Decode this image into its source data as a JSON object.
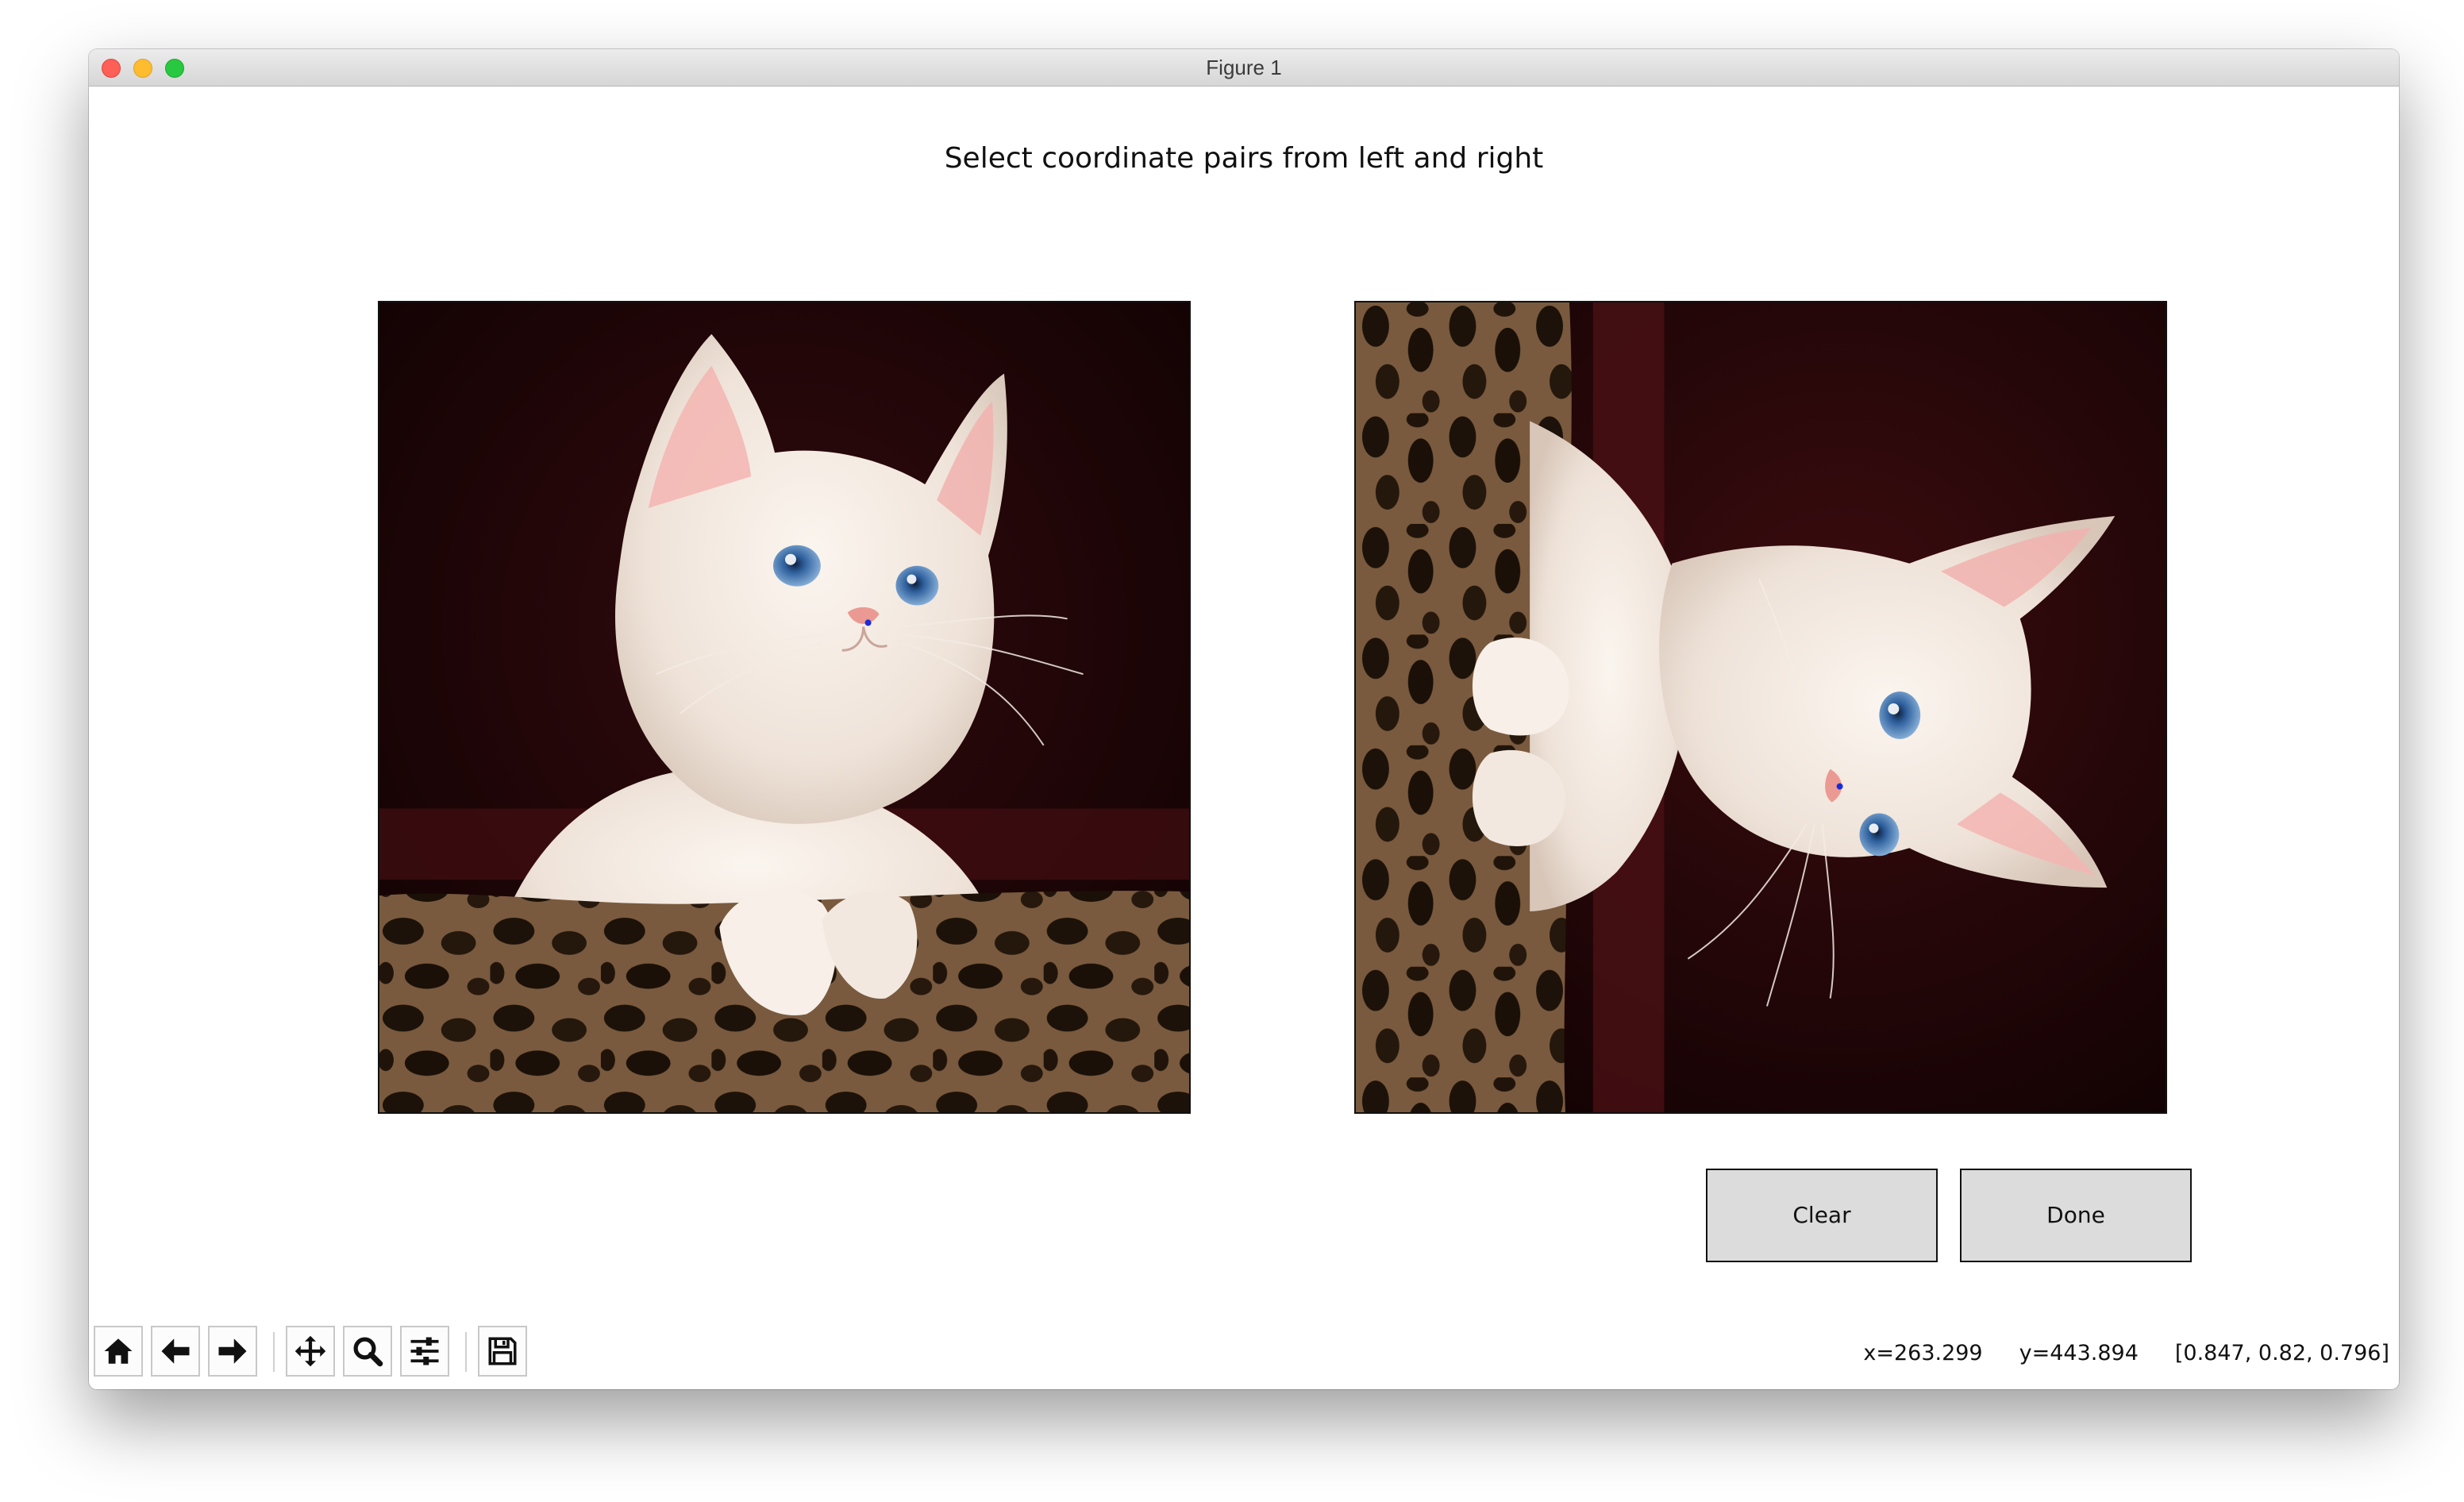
{
  "window": {
    "title": "Figure 1"
  },
  "figure": {
    "suptitle": "Select coordinate pairs from left and right",
    "images": [
      {
        "name": "kitten-original",
        "orientation": "upright"
      },
      {
        "name": "kitten-rotated",
        "orientation": "rotated-90"
      }
    ]
  },
  "buttons": {
    "clear_label": "Clear",
    "done_label": "Done"
  },
  "toolbar": {
    "tools": [
      "home-icon",
      "back-arrow-icon",
      "forward-arrow-icon",
      "pan-icon",
      "zoom-icon",
      "configure-subplots-icon",
      "save-icon"
    ]
  },
  "status": {
    "x": "x=263.299",
    "y": "y=443.894",
    "rgb": "[0.847, 0.82, 0.796]"
  },
  "colors": {
    "button_bg": "#dcdcdc",
    "background_dark": "#1e0507",
    "fur_light": "#f1e6dd",
    "leopard_base": "#7a5a3e",
    "eye_blue": "#5b8dc9"
  }
}
